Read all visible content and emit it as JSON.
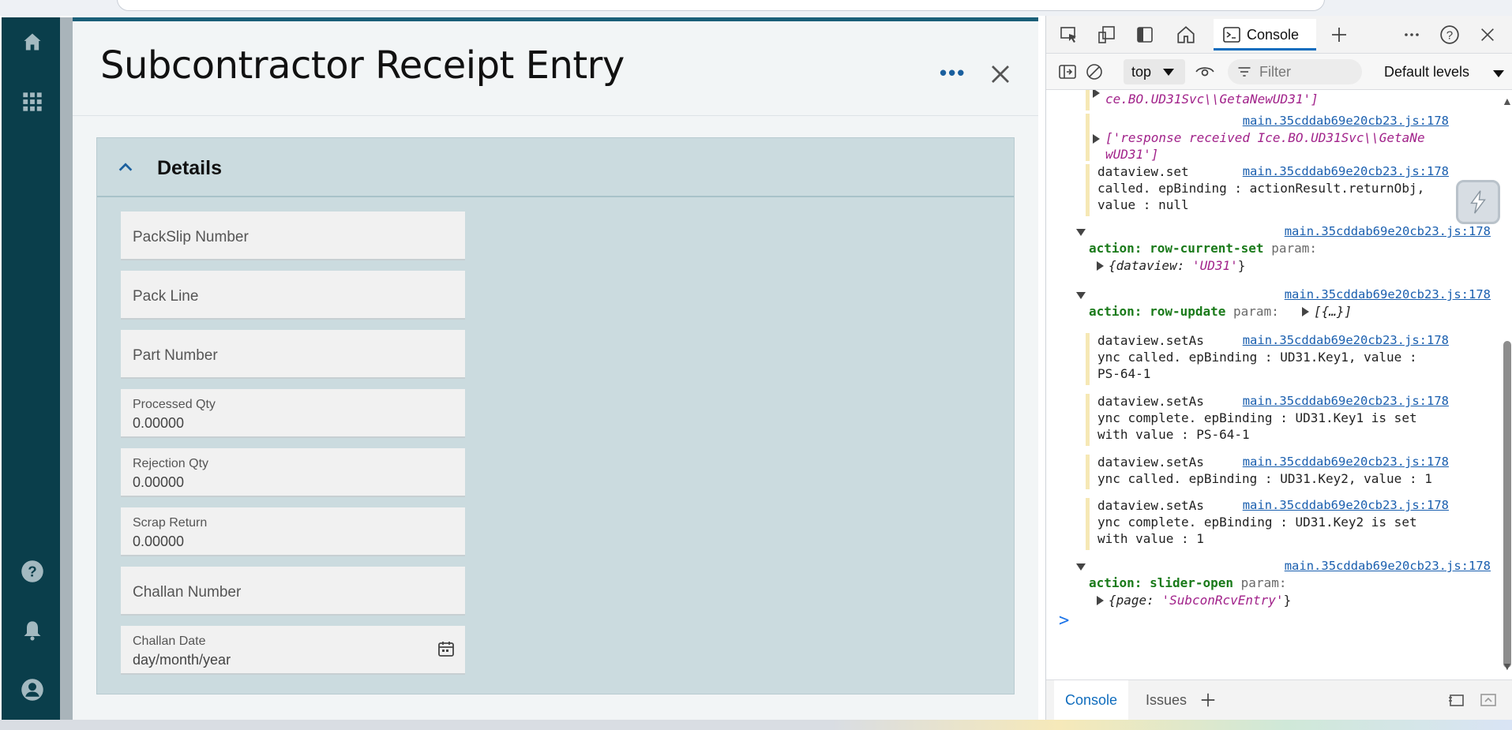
{
  "app": {
    "title": "Subcontractor Receipt Entry",
    "more_label": "•••",
    "section_title": "Details",
    "fields": [
      {
        "placeholder": "PackSlip Number"
      },
      {
        "placeholder": "Pack Line"
      },
      {
        "placeholder": "Part Number"
      },
      {
        "label": "Processed Qty",
        "value": "0.00000"
      },
      {
        "label": "Rejection Qty",
        "value": "0.00000"
      },
      {
        "label": "Scrap Return",
        "value": "0.00000"
      },
      {
        "placeholder": "Challan Number"
      },
      {
        "label": "Challan Date",
        "value": "day/month/year"
      }
    ],
    "colors": {
      "nav": "#0a3e4b",
      "accent": "#1a5f78",
      "panel": "#cbdbdf"
    }
  },
  "devtools": {
    "tab_console": "Console",
    "context": "top",
    "filter_placeholder": "Filter",
    "levels": "Default levels",
    "bottom_tabs": {
      "console": "Console",
      "issues": "Issues"
    },
    "prompt": ">",
    "log": {
      "l0a": "ce.BO.UD31Svc\\\\GetaNewUD31']",
      "link": "main.35cddab69e20cb23.js:178",
      "l1a": "['response received Ice.BO.UD31Svc\\\\GetaNe",
      "l1b": "wUD31']",
      "l2a": "dataview.set",
      "l2b": "called. epBinding : actionResult.returnObj,",
      "l2c": "value : null",
      "l3_action": "action: row-current-set",
      "param": "param:",
      "l3_obj_key": "{dataview: ",
      "l3_obj_val": "'UD31'",
      "l3_obj_end": "}",
      "l4_action": "action: row-update",
      "l4_obj": "[{…}]",
      "l5a": "dataview.setAs",
      "l5b": "ync called. epBinding : UD31.Key1, value :",
      "l5c": "PS-64-1",
      "l6a": "dataview.setAs",
      "l6b": "ync complete. epBinding : UD31.Key1 is set",
      "l6c": "with value : PS-64-1",
      "l7a": "dataview.setAs",
      "l7b": "ync called. epBinding : UD31.Key2, value : 1",
      "l8a": "dataview.setAs",
      "l8b": "ync complete. epBinding : UD31.Key2 is set",
      "l8c": "with value : 1",
      "l9_action": "action: slider-open",
      "l9_obj_key": "{page: ",
      "l9_obj_val": "'SubconRcvEntry'",
      "l9_obj_end": "}"
    }
  }
}
